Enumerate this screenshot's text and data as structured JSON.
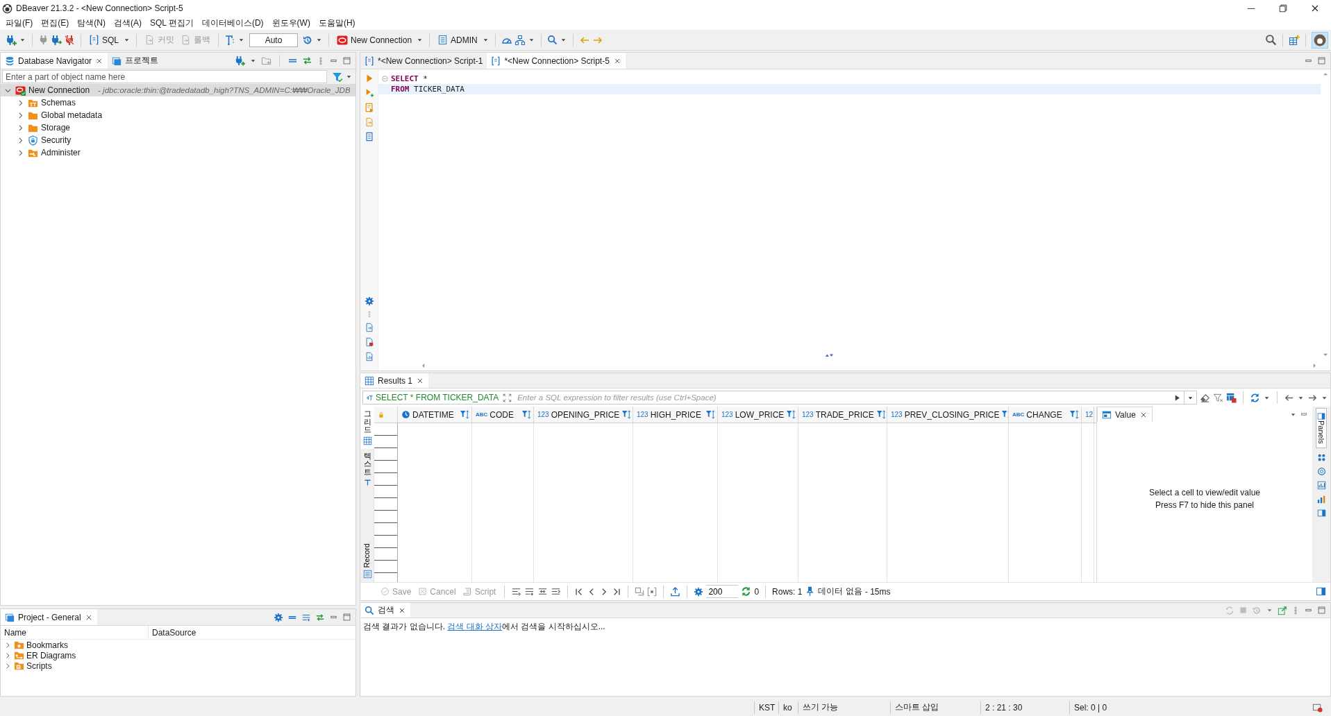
{
  "window": {
    "title": "DBeaver 21.3.2 - <New Connection> Script-5"
  },
  "menu": [
    "파일(F)",
    "편집(E)",
    "탐색(N)",
    "검색(A)",
    "SQL 편집기",
    "데이터베이스(D)",
    "윈도우(W)",
    "도움말(H)"
  ],
  "toolbar": {
    "sql": "SQL",
    "commit": {
      "label": "커밋",
      "disabled": true
    },
    "rollback": {
      "label": "롤백",
      "disabled": true
    },
    "transaction_mode": "Auto",
    "connection": "New Connection",
    "schema": "ADMIN"
  },
  "navigator": {
    "tabs": [
      {
        "label": "Database Navigator",
        "selected": true
      },
      {
        "label": "프로젝트",
        "selected": false
      }
    ],
    "filter": {
      "placeholder": "Enter a part of object name here"
    },
    "tree": [
      {
        "label": "New Connection",
        "detail": "- jdbc:oracle:thin:@tradedatadb_high?TNS_ADMIN=C:₩₩Oracle_JDB",
        "kind": "connection",
        "expanded": true,
        "selected": true,
        "children": [
          {
            "label": "Schemas",
            "kind": "schemas",
            "expanded": false,
            "selected": false
          },
          {
            "label": "Global metadata",
            "kind": "folder",
            "expanded": false,
            "selected": false
          },
          {
            "label": "Storage",
            "kind": "folder",
            "expanded": false,
            "selected": false
          },
          {
            "label": "Security",
            "kind": "security",
            "expanded": false,
            "selected": false
          },
          {
            "label": "Administer",
            "kind": "administer",
            "expanded": false,
            "selected": false
          }
        ]
      }
    ]
  },
  "project": {
    "title": "Project - General",
    "columns": [
      "Name",
      "DataSource"
    ],
    "items": [
      {
        "label": "Bookmarks",
        "kind": "bookmarks",
        "expanded": false
      },
      {
        "label": "ER Diagrams",
        "kind": "diagrams",
        "expanded": false
      },
      {
        "label": "Scripts",
        "kind": "scripts",
        "expanded": false
      }
    ]
  },
  "editor": {
    "tabs": [
      {
        "label": "*<New Connection> Script-1",
        "selected": false
      },
      {
        "label": "*<New Connection> Script-5",
        "selected": true
      }
    ],
    "lines": [
      {
        "code": "**SELECT** *",
        "current": false
      },
      {
        "code": "   **FROM** TICKER_DATA",
        "current": true
      }
    ]
  },
  "results": {
    "tabs": [
      {
        "label": "Results 1",
        "selected": true
      }
    ],
    "query": "SELECT * FROM TICKER_DATA",
    "filter": {
      "placeholder": "Enter a SQL expression to filter results (use Ctrl+Space)"
    },
    "views": [
      {
        "label": "그리드",
        "selected": true
      },
      {
        "label": "텍스트",
        "selected": false
      },
      {
        "label": "Record",
        "selected": false
      }
    ],
    "columns": [
      {
        "kind": "date",
        "name": "DATETIME"
      },
      {
        "kind": "text",
        "type_label": "ABC",
        "name": "CODE"
      },
      {
        "kind": "number",
        "type_label": "123",
        "name": "OPENING_PRICE"
      },
      {
        "kind": "number",
        "type_label": "123",
        "name": "HIGH_PRICE"
      },
      {
        "kind": "number",
        "type_label": "123",
        "name": "LOW_PRICE"
      },
      {
        "kind": "number",
        "type_label": "123",
        "name": "TRADE_PRICE"
      },
      {
        "kind": "number",
        "type_label": "123",
        "name": "PREV_CLOSING_PRICE"
      },
      {
        "kind": "text",
        "type_label": "ABC",
        "name": "CHANGE"
      },
      {
        "kind": "number",
        "type_label": "12"
      }
    ],
    "value_panel": {
      "title": "Value",
      "hints": [
        "Select a cell to view/edit value",
        "Press F7 to hide this panel"
      ]
    },
    "side_panel": "Panels",
    "actions": [
      {
        "label": "Save",
        "disabled": true
      },
      {
        "label": "Cancel",
        "disabled": true
      },
      {
        "label": "Script",
        "disabled": true
      }
    ],
    "fetch_size": "200",
    "fetched": "0",
    "rows": "Rows: 1",
    "status": "데이터 없음",
    "duration": "- 15ms"
  },
  "search": {
    "tab": "검색",
    "message": {
      "before": "검색 결과가 없습니다. ",
      "link": "검색 대화 상자",
      "after": "에서 검색을 시작하십시오..."
    }
  },
  "status_bar": [
    "KST",
    "ko",
    "쓰기 가능",
    "스마트 삽입",
    "2 : 21 : 30",
    "Sel: 0 | 0"
  ]
}
